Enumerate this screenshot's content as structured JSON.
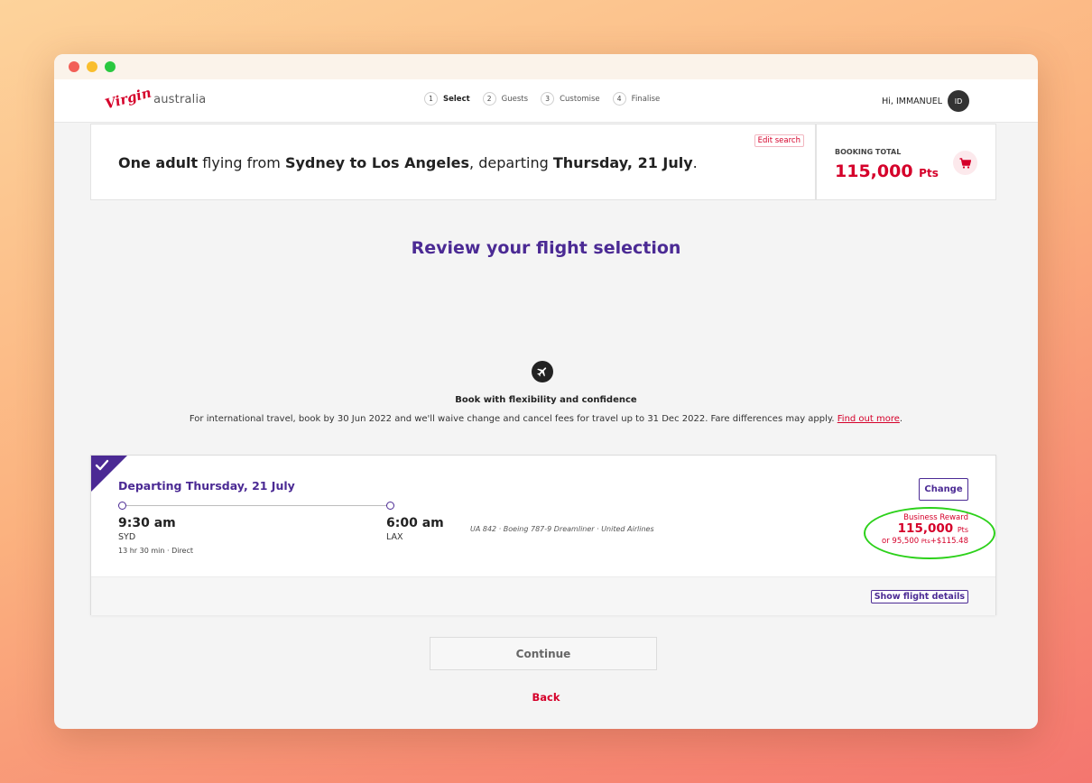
{
  "logo": {
    "mark": "Virgin",
    "text": "australia"
  },
  "steps": [
    {
      "num": "1",
      "label": "Select",
      "active": true
    },
    {
      "num": "2",
      "label": "Guests",
      "active": false
    },
    {
      "num": "3",
      "label": "Customise",
      "active": false
    },
    {
      "num": "4",
      "label": "Finalise",
      "active": false
    }
  ],
  "user": {
    "greeting": "Hi, IMMANUEL",
    "initials": "ID"
  },
  "summary": {
    "edit_label": "Edit search",
    "passengers": "One adult",
    "t1": " flying from ",
    "route": "Sydney to Los Angeles",
    "t2": ", departing ",
    "date": "Thursday, 21 July",
    "t3": "."
  },
  "booking_total": {
    "label": "BOOKING TOTAL",
    "amount": "115,000",
    "unit": "Pts"
  },
  "page_title": "Review your flight selection",
  "flex": {
    "heading": "Book with flexibility and confidence",
    "text": "For international travel, book by 30 Jun 2022 and we'll waive change and cancel fees for travel up to 31 Dec 2022. Fare differences may apply. ",
    "link": "Find out more",
    "end": "."
  },
  "flight": {
    "title": "Departing Thursday, 21 July",
    "dep_time": "9:30 am",
    "dep_code": "SYD",
    "duration": "13 hr 30 min · Direct",
    "arr_time": "6:00 am",
    "arr_code": "LAX",
    "aircraft": "UA 842 · Boeing 787-9 Dreamliner · United Airlines",
    "change_label": "Change",
    "fare_name": "Business Reward",
    "fare_points": "115,000",
    "fare_unit": "Pts",
    "alt_prefix": "or 95,500 ",
    "alt_unit": "Pts",
    "alt_suffix": "+$115.48",
    "details_label": "Show flight details"
  },
  "continue_label": "Continue",
  "back_label": "Back",
  "colors": {
    "brand_red": "#d5002a",
    "brand_purple": "#4b2a94",
    "highlight_green": "#2cd11a"
  }
}
